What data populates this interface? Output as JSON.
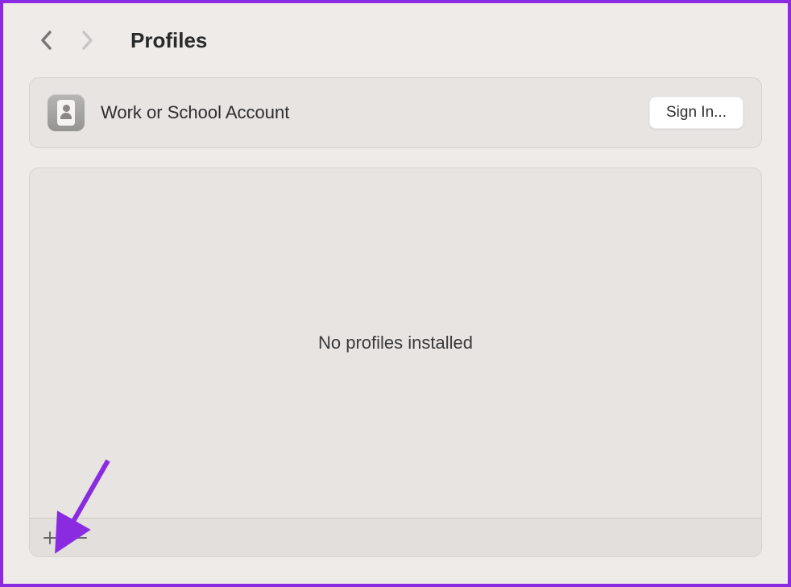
{
  "header": {
    "title": "Profiles"
  },
  "account": {
    "label": "Work or School Account",
    "signin_label": "Sign In..."
  },
  "profiles": {
    "empty_message": "No profiles installed"
  },
  "icons": {
    "back": "chevron-left",
    "forward": "chevron-right",
    "add": "plus",
    "remove": "minus"
  }
}
